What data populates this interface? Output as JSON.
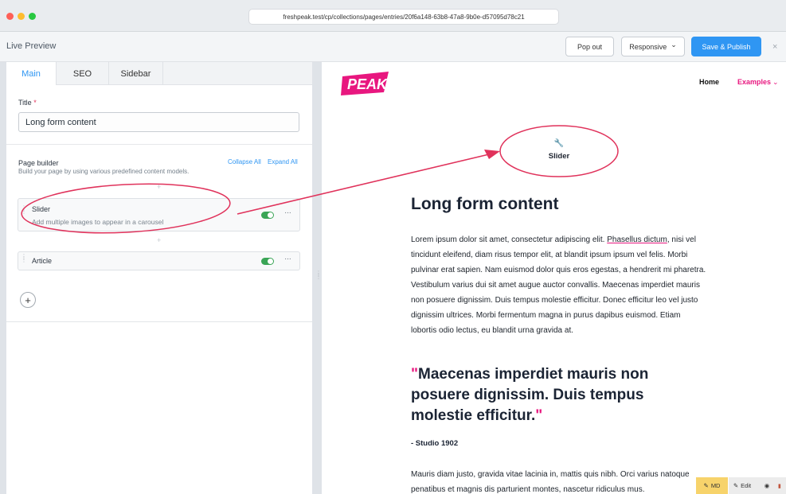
{
  "browser": {
    "url": "freshpeak.test/cp/collections/pages/entries/20f6a148-63b8-47a8-9b0e-d57095d78c21",
    "traffic_colors": [
      "#fe5f57",
      "#febc2e",
      "#28c840"
    ]
  },
  "header": {
    "title": "Live Preview",
    "pop_out": "Pop out",
    "responsive": "Responsive",
    "responsive_chevron": "⌄",
    "save": "Save & Publish",
    "close": "×"
  },
  "editor": {
    "tabs": [
      {
        "label": "Main"
      },
      {
        "label": "SEO"
      },
      {
        "label": "Sidebar"
      }
    ],
    "title_label": "Title",
    "title_required": "*",
    "title_value": "Long form content",
    "page_builder": {
      "label": "Page builder",
      "help": "Build your page by using various predefined content models.",
      "collapse_all": "Collapse All",
      "expand_all": "Expand All",
      "sets": [
        {
          "title": "Slider",
          "subtitle": "Add multiple images to appear in a carousel",
          "enabled": true
        },
        {
          "title": "Article",
          "subtitle": "",
          "enabled": true
        }
      ],
      "add": "+",
      "more": "···"
    }
  },
  "preview": {
    "logo": "PEAK",
    "nav": {
      "home": "Home",
      "examples": "Examples",
      "examples_chevron": "⌄"
    },
    "slider_label": "Slider",
    "slider_icon": "🔧",
    "heading": "Long form content",
    "paragraph_before_link": "Lorem ipsum dolor sit amet, consectetur adipiscing elit. ",
    "paragraph_link": "Phasellus dictum",
    "paragraph_after_link": ", nisi vel tincidunt eleifend, diam risus tempor elit, at blandit ipsum ipsum vel felis. Morbi pulvinar erat sapien. Nam euismod dolor quis eros egestas, a hendrerit mi pharetra. Vestibulum varius dui sit amet augue auctor convallis. Maecenas imperdiet mauris non posuere dignissim. Duis tempus molestie efficitur. Donec efficitur leo vel justo dignissim ultrices. Morbi fermentum magna in purus dapibus euismod. Etiam lobortis odio lectus, eu blandit urna gravida at.",
    "quote_open": "\"",
    "quote": "Maecenas imperdiet mauris non posuere dignissim. Duis tempus molestie efficitur.",
    "quote_close": "\"",
    "cite": "- Studio 1902",
    "paragraph2": "Mauris diam justo, gravida vitae lacinia in, mattis quis nibh. Orci varius natoque penatibus et magnis dis parturient montes, nascetur ridiculus mus."
  },
  "toolbar": {
    "md": "MD",
    "edit": "Edit"
  },
  "colors": {
    "accent": "#2f96f3",
    "brand_pink": "#e8177f",
    "annotation": "#e0325b",
    "toggle_on": "#3aa556"
  }
}
